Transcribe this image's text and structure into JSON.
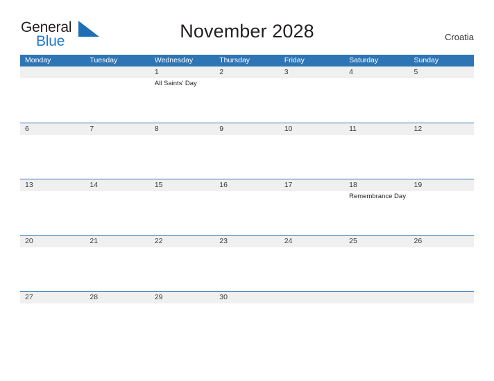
{
  "brand": {
    "name_part1": "General",
    "name_part2": "Blue",
    "flag_icon": "blue-triangle-flag-icon",
    "color_dark": "#231f20",
    "color_blue": "#1f7ad4"
  },
  "header": {
    "title": "November 2028",
    "country": "Croatia"
  },
  "theme": {
    "header_blue": "#2e75b6",
    "band_gray": "#f0f0f0",
    "text_dark": "#231f20",
    "date_text": "#3a3a3a"
  },
  "calendar": {
    "month": "November",
    "year": "2028",
    "weekday_headers": [
      "Monday",
      "Tuesday",
      "Wednesday",
      "Thursday",
      "Friday",
      "Saturday",
      "Sunday"
    ],
    "weeks": [
      {
        "days": [
          {
            "num": "",
            "events": []
          },
          {
            "num": "",
            "events": []
          },
          {
            "num": "1",
            "events": [
              "All Saints' Day"
            ]
          },
          {
            "num": "2",
            "events": []
          },
          {
            "num": "3",
            "events": []
          },
          {
            "num": "4",
            "events": []
          },
          {
            "num": "5",
            "events": []
          }
        ]
      },
      {
        "days": [
          {
            "num": "6",
            "events": []
          },
          {
            "num": "7",
            "events": []
          },
          {
            "num": "8",
            "events": []
          },
          {
            "num": "9",
            "events": []
          },
          {
            "num": "10",
            "events": []
          },
          {
            "num": "11",
            "events": []
          },
          {
            "num": "12",
            "events": []
          }
        ]
      },
      {
        "days": [
          {
            "num": "13",
            "events": []
          },
          {
            "num": "14",
            "events": []
          },
          {
            "num": "15",
            "events": []
          },
          {
            "num": "16",
            "events": []
          },
          {
            "num": "17",
            "events": []
          },
          {
            "num": "18",
            "events": [
              "Remembrance Day"
            ]
          },
          {
            "num": "19",
            "events": []
          }
        ]
      },
      {
        "days": [
          {
            "num": "20",
            "events": []
          },
          {
            "num": "21",
            "events": []
          },
          {
            "num": "22",
            "events": []
          },
          {
            "num": "23",
            "events": []
          },
          {
            "num": "24",
            "events": []
          },
          {
            "num": "25",
            "events": []
          },
          {
            "num": "26",
            "events": []
          }
        ]
      },
      {
        "days": [
          {
            "num": "27",
            "events": []
          },
          {
            "num": "28",
            "events": []
          },
          {
            "num": "29",
            "events": []
          },
          {
            "num": "30",
            "events": []
          },
          {
            "num": "",
            "events": []
          },
          {
            "num": "",
            "events": []
          },
          {
            "num": "",
            "events": []
          }
        ]
      }
    ]
  }
}
